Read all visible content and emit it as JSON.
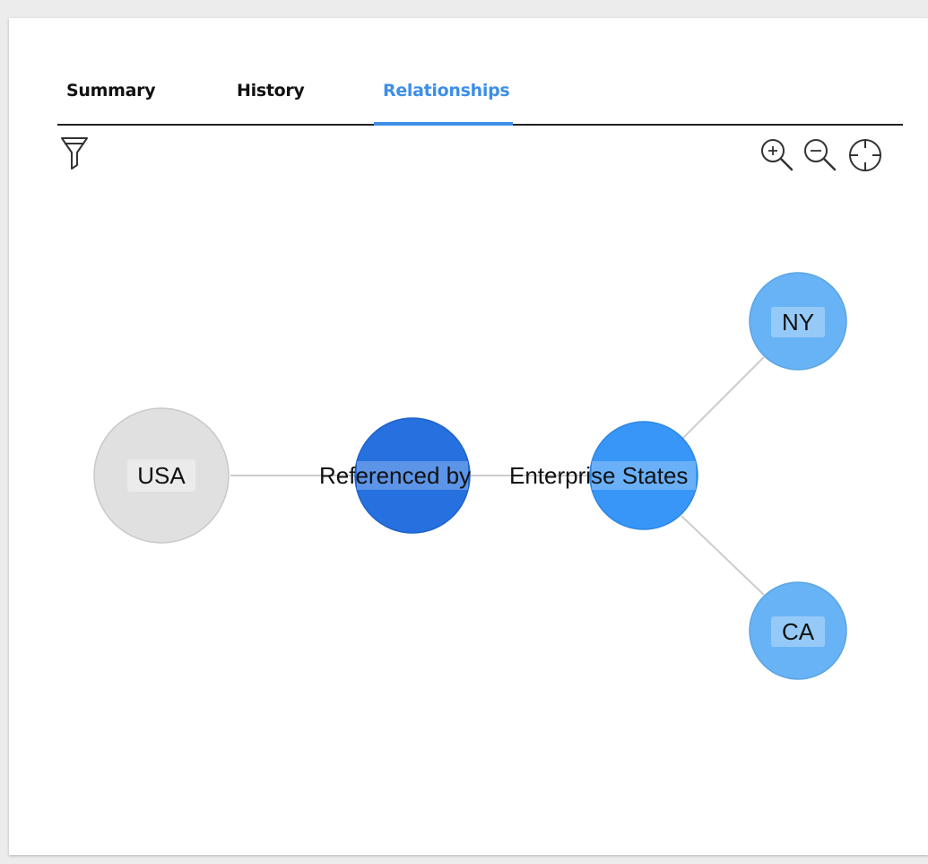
{
  "tabs": {
    "summary": "Summary",
    "history": "History",
    "relationships": "Relationships",
    "active": "Relationships"
  },
  "toolbar": {
    "filter_icon": "filter-icon",
    "zoom_in_icon": "zoom-in-icon",
    "zoom_out_icon": "zoom-out-icon",
    "recenter_icon": "crosshair-icon"
  },
  "graph": {
    "nodes": {
      "usa": {
        "label": "USA",
        "color": "#e0e0e0"
      },
      "relation": {
        "label": "",
        "color": "#2670df"
      },
      "enterprise_states": {
        "label": "",
        "color": "#3796f7"
      },
      "ny": {
        "label": "NY",
        "color": "#68b3f5"
      },
      "ca": {
        "label": "CA",
        "color": "#68b3f5"
      }
    },
    "edge_labels": {
      "relation": "Referenced by",
      "target": "Enterprise States"
    },
    "edge_color": "#cccccc",
    "accent_color": "#3d8fe6"
  }
}
